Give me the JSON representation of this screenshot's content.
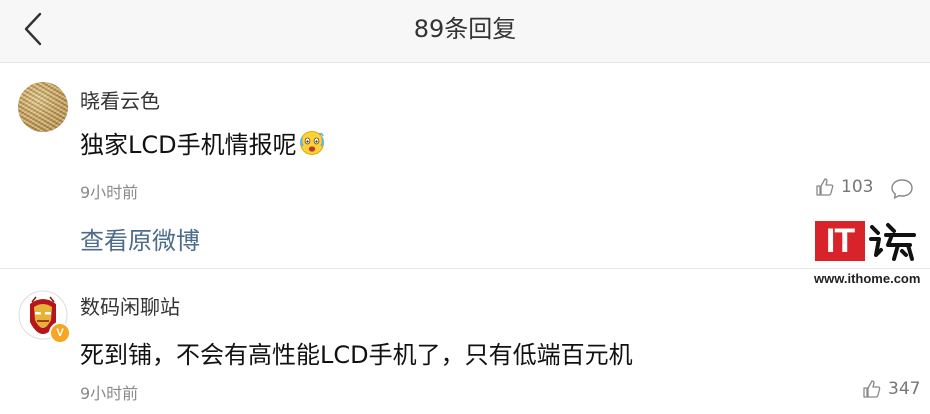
{
  "header": {
    "title": "89条回复",
    "back_icon": "chevron-left-icon"
  },
  "comments": [
    {
      "username": "晓看云色",
      "text": "独家LCD手机情报呢",
      "emoji": "crying-face-emoji",
      "time": "9小时前",
      "likes": "103",
      "view_original": "查看原微博"
    },
    {
      "username": "数码闲聊站",
      "badge": "V",
      "text": "死到铺，不会有高性能LCD手机了，只有低端百元机",
      "time": "9小时前",
      "likes": "347"
    }
  ],
  "watermark": {
    "logo": "IT",
    "url": "www.ithome.com"
  },
  "colors": {
    "link": "#4d6b8a",
    "badge": "#f5a623",
    "watermark_red": "#d8232a"
  }
}
